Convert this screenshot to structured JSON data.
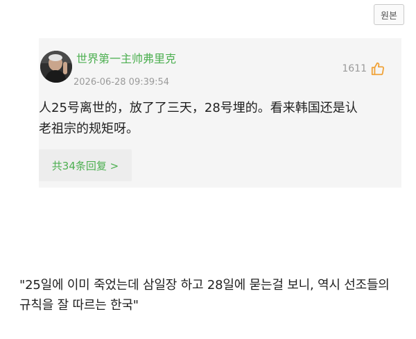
{
  "header": {
    "original_button_label": "원본"
  },
  "comment": {
    "username": "世界第一主帅弗里克",
    "timestamp": "2026-06-28 09:39:54",
    "like_count": "1611",
    "text": "人25号离世的，放了了三天，28号埋的。看来韩国还是认老祖宗的规矩呀。",
    "replies_label": "共34条回复 >"
  },
  "translation": {
    "text": "\"25일에 이미 죽었는데 삼일장 하고 28일에 묻는걸 보니, 역시 선조들의 규칙을 잘 따르는 한국\""
  },
  "colors": {
    "accent_green": "#4caf50",
    "card_background": "#f5f5f5",
    "like_icon_color": "#f0a33a"
  },
  "icons": {
    "avatar": "user-avatar-photo",
    "like": "thumbs-up-icon"
  }
}
